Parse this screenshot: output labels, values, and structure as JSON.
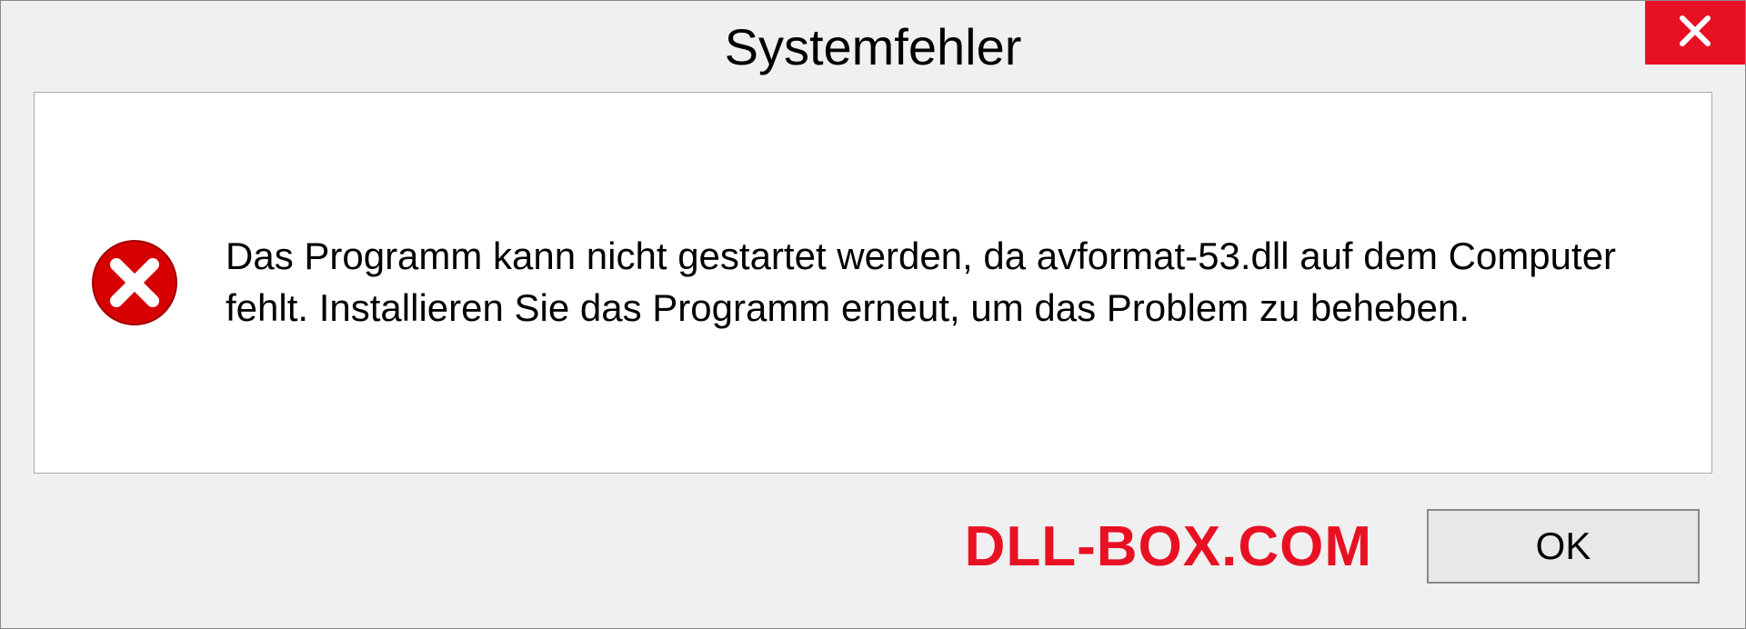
{
  "dialog": {
    "title": "Systemfehler",
    "message": "Das Programm kann nicht gestartet werden, da avformat-53.dll auf dem Computer fehlt. Installieren Sie das Programm erneut, um das Problem zu beheben.",
    "ok_label": "OK"
  },
  "watermark": "DLL-BOX.COM",
  "colors": {
    "error_red": "#e81123",
    "close_bg": "#e81123"
  }
}
